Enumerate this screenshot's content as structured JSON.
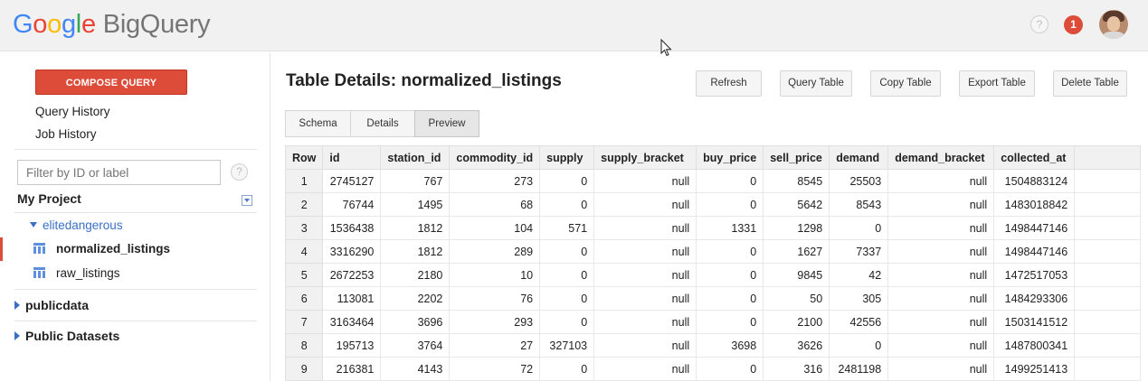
{
  "brand": {
    "google": [
      "G",
      "o",
      "o",
      "g",
      "l",
      "e"
    ],
    "product": "BigQuery"
  },
  "header": {
    "help_glyph": "?",
    "notification_count": "1"
  },
  "sidebar": {
    "compose_label": "COMPOSE QUERY",
    "links": [
      "Query History",
      "Job History"
    ],
    "filter_placeholder": "Filter by ID or label",
    "filter_help": "?",
    "project": "My Project",
    "dataset": "elitedangerous",
    "tables": [
      {
        "name": "normalized_listings",
        "active": true
      },
      {
        "name": "raw_listings",
        "active": false
      }
    ],
    "groups": [
      "publicdata",
      "Public Datasets"
    ]
  },
  "main": {
    "title": "Table Details: normalized_listings",
    "buttons": [
      "Refresh",
      "Query Table",
      "Copy Table",
      "Export Table",
      "Delete Table"
    ],
    "tabs": [
      "Schema",
      "Details",
      "Preview"
    ],
    "active_tab": "Preview",
    "columns": [
      "Row",
      "id",
      "station_id",
      "commodity_id",
      "supply",
      "supply_bracket",
      "buy_price",
      "sell_price",
      "demand",
      "demand_bracket",
      "collected_at"
    ],
    "rows": [
      [
        "1",
        "2745127",
        "767",
        "273",
        "0",
        "null",
        "0",
        "8545",
        "25503",
        "null",
        "1504883124"
      ],
      [
        "2",
        "76744",
        "1495",
        "68",
        "0",
        "null",
        "0",
        "5642",
        "8543",
        "null",
        "1483018842"
      ],
      [
        "3",
        "1536438",
        "1812",
        "104",
        "571",
        "null",
        "1331",
        "1298",
        "0",
        "null",
        "1498447146"
      ],
      [
        "4",
        "3316290",
        "1812",
        "289",
        "0",
        "null",
        "0",
        "1627",
        "7337",
        "null",
        "1498447146"
      ],
      [
        "5",
        "2672253",
        "2180",
        "10",
        "0",
        "null",
        "0",
        "9845",
        "42",
        "null",
        "1472517053"
      ],
      [
        "6",
        "113081",
        "2202",
        "76",
        "0",
        "null",
        "0",
        "50",
        "305",
        "null",
        "1484293306"
      ],
      [
        "7",
        "3163464",
        "3696",
        "293",
        "0",
        "null",
        "0",
        "2100",
        "42556",
        "null",
        "1503141512"
      ],
      [
        "8",
        "195713",
        "3764",
        "27",
        "327103",
        "null",
        "3698",
        "3626",
        "0",
        "null",
        "1487800341"
      ],
      [
        "9",
        "216381",
        "4143",
        "72",
        "0",
        "null",
        "0",
        "316",
        "2481198",
        "null",
        "1499251413"
      ]
    ]
  }
}
